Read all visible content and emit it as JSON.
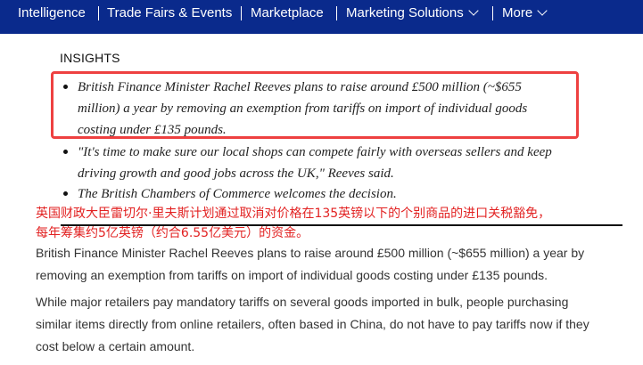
{
  "nav": {
    "items": [
      "Intelligence",
      "Trade Fairs & Events",
      "Marketplace",
      "Marketing Solutions",
      "More"
    ],
    "background": "#0a2a8c"
  },
  "insights": {
    "label": "INSIGHTS",
    "bullets": [
      {
        "lines": [
          "British Finance Minister Rachel Reeves plans to raise around £500 million (~$655",
          "million) a year by removing an exemption from tariffs on import of individual goods",
          "costing under £135 pounds."
        ],
        "highlighted": true
      },
      {
        "lines": [
          "\"It's time to make sure our local shops can compete fairly with overseas sellers and keep",
          "driving growth and good jobs across the UK,\" Reeves said."
        ],
        "highlighted": false
      },
      {
        "lines": [
          "The British Chambers of Commerce welcomes the decision."
        ],
        "highlighted": false
      }
    ],
    "highlight_color": "#ee4040"
  },
  "annotation": {
    "lines": [
      "英国财政大臣雷切尔·里夫斯计划通过取消对价格在135英镑以下的个别商品的进口关税豁免，",
      "每年筹集约5亿英镑（约合6.55亿美元）的资金。"
    ],
    "color": "#e22222"
  },
  "article": {
    "paragraphs": [
      {
        "lines": [
          "British Finance Minister Rachel Reeves plans to raise around £500 million (~$655 million) a year by",
          "removing an exemption from tariffs on import of individual goods costing under £135 pounds."
        ]
      },
      {
        "lines": [
          "While major retailers pay mandatory tariffs on several goods imported in bulk, people purchasing",
          "similar items directly from online retailers, often based in China, do not have to pay tariffs now if they",
          "cost below a certain amount."
        ]
      }
    ]
  }
}
